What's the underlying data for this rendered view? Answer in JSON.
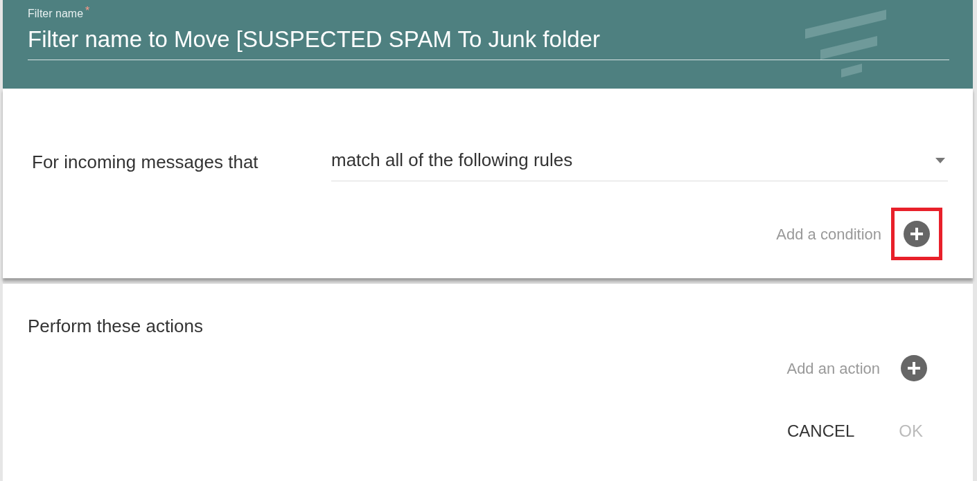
{
  "filter_name": {
    "label": "Filter name",
    "required": true,
    "required_mark": "*",
    "value": "Filter name to Move [SUSPECTED SPAM To Junk folder"
  },
  "conditions": {
    "label": "For incoming messages that",
    "select_value": "match all of the following rules",
    "add_label": "Add a condition",
    "highlighted": true
  },
  "actions": {
    "title": "Perform these actions",
    "add_label": "Add an action"
  },
  "buttons": [
    {
      "label": "CANCEL",
      "disabled": false
    },
    {
      "label": "OK",
      "disabled": true
    }
  ]
}
